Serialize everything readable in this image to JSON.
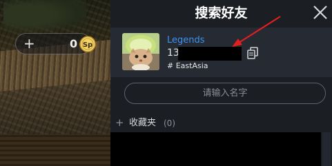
{
  "hud": {
    "add_icon": "plus-icon",
    "currency_amount": "0",
    "currency_icon": "coin-icon",
    "coin_glyph": "Sp"
  },
  "dialog": {
    "title": "搜索好友",
    "close_icon": "close-icon"
  },
  "search_result": {
    "name": "Legends",
    "id_prefix": "13",
    "region": "# EastAsia",
    "copy_icon": "copy-icon",
    "name_color": "#3d93f2"
  },
  "search": {
    "placeholder": "请输入名字",
    "value": ""
  },
  "favorites": {
    "expand_icon": "plus-icon",
    "label": "收藏夹",
    "count": "(0)"
  },
  "colors": {
    "panel_bg": "#1b1e23",
    "card_bg": "#252a33",
    "annotation_red": "#e0201c"
  }
}
